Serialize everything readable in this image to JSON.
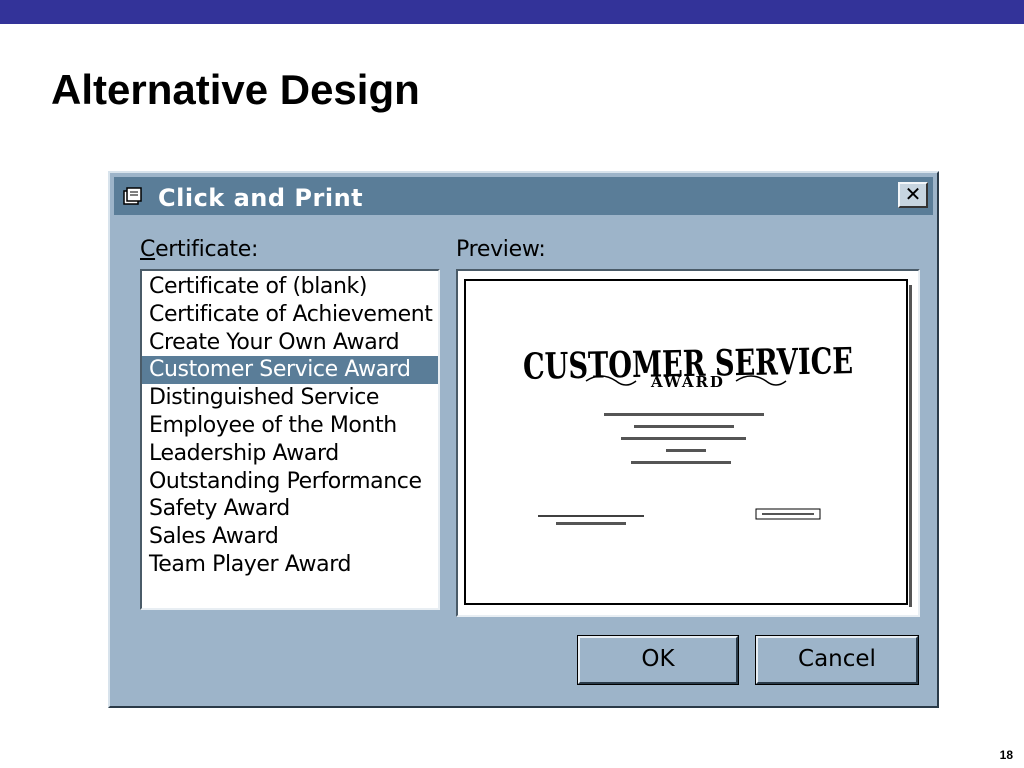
{
  "slide": {
    "title": "Alternative Design",
    "page_number": "18"
  },
  "dialog": {
    "title": "Click and Print",
    "close_icon": "close-x-icon",
    "certificate_label": "Certificate:",
    "preview_label": "Preview:",
    "certificates": [
      "Certificate of (blank)",
      "Certificate of Achievement",
      "Create Your Own Award",
      "Customer Service Award",
      "Distinguished Service",
      "Employee of the Month",
      "Leadership Award",
      "Outstanding Performance",
      "Safety Award",
      "Sales Award",
      "Team Player Award"
    ],
    "selected_certificate": "Customer Service Award",
    "preview": {
      "heading": "CUSTOMER SERVICE",
      "subheading": "AWARD"
    },
    "ok_label": "OK",
    "cancel_label": "Cancel"
  },
  "colors": {
    "slide_bar": "#333399",
    "dialog_face": "#9db4c9",
    "titlebar": "#5a7d98",
    "selection": "#5a7d98"
  }
}
